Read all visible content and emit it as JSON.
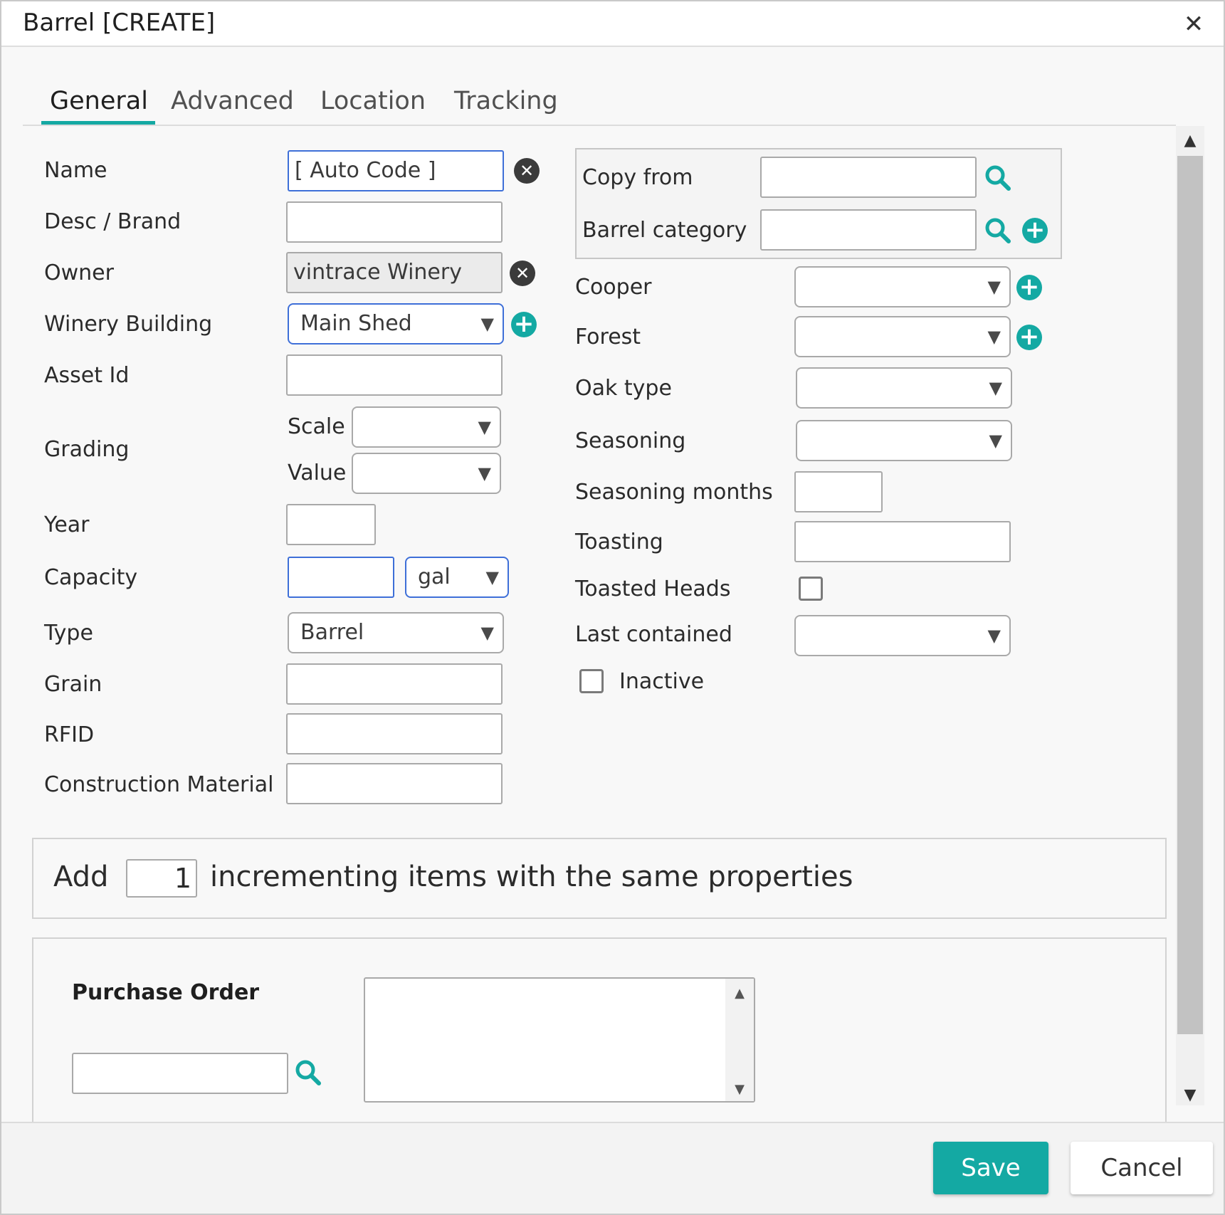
{
  "dialog": {
    "title": "Barrel [CREATE]",
    "close_icon": "close-icon"
  },
  "tabs": [
    {
      "label": "General",
      "active": true
    },
    {
      "label": "Advanced",
      "active": false
    },
    {
      "label": "Location",
      "active": false
    },
    {
      "label": "Tracking",
      "active": false
    }
  ],
  "left_form": {
    "name": {
      "label": "Name",
      "value": "[ Auto Code ]"
    },
    "desc_brand": {
      "label": "Desc / Brand",
      "value": ""
    },
    "owner": {
      "label": "Owner",
      "value": "vintrace Winery"
    },
    "winery_building": {
      "label": "Winery Building",
      "value": "Main Shed"
    },
    "asset_id": {
      "label": "Asset Id",
      "value": ""
    },
    "grading": {
      "label": "Grading",
      "scale_label": "Scale",
      "value_label": "Value",
      "scale": "",
      "value": ""
    },
    "year": {
      "label": "Year",
      "value": ""
    },
    "capacity": {
      "label": "Capacity",
      "value": "",
      "unit": "gal"
    },
    "type": {
      "label": "Type",
      "value": "Barrel"
    },
    "grain": {
      "label": "Grain",
      "value": ""
    },
    "rfid": {
      "label": "RFID",
      "value": ""
    },
    "construction_material": {
      "label": "Construction Material",
      "value": ""
    }
  },
  "right_form": {
    "copy_from": {
      "label": "Copy from",
      "value": ""
    },
    "barrel_category": {
      "label": "Barrel category",
      "value": ""
    },
    "cooper": {
      "label": "Cooper",
      "value": ""
    },
    "forest": {
      "label": "Forest",
      "value": ""
    },
    "oak_type": {
      "label": "Oak type",
      "value": ""
    },
    "seasoning": {
      "label": "Seasoning",
      "value": ""
    },
    "seasoning_months": {
      "label": "Seasoning months",
      "value": ""
    },
    "toasting": {
      "label": "Toasting",
      "value": ""
    },
    "toasted_heads": {
      "label": "Toasted Heads",
      "checked": false
    },
    "last_contained": {
      "label": "Last contained",
      "value": ""
    },
    "inactive": {
      "label": "Inactive",
      "checked": false
    }
  },
  "incrementing": {
    "prefix": "Add",
    "count": "1",
    "suffix": "incrementing items with the same properties"
  },
  "purchase_order": {
    "label": "Purchase Order",
    "value": "",
    "notes": ""
  },
  "footer": {
    "save_label": "Save",
    "cancel_label": "Cancel"
  },
  "colors": {
    "accent": "#14a9a3",
    "focus_border": "#3e6fd8",
    "clear_icon": "#3b3b3b"
  },
  "glyphs": {
    "dropdown_arrow": "▼",
    "plus": "+",
    "clear": "✕",
    "close": "✕",
    "scroll_up": "▲",
    "scroll_down": "▼"
  }
}
